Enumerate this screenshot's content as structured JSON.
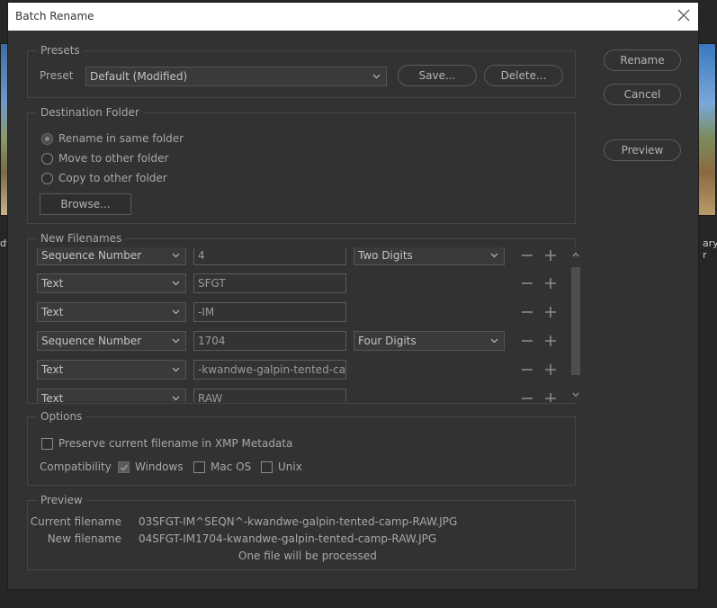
{
  "background": {
    "caption_left": "dv",
    "caption_right": "ary-r"
  },
  "dialog": {
    "title": "Batch Rename",
    "buttons": {
      "rename": "Rename",
      "cancel": "Cancel",
      "preview": "Preview"
    }
  },
  "presets": {
    "legend": "Presets",
    "preset_label": "Preset",
    "preset_value": "Default (Modified)",
    "save": "Save...",
    "delete": "Delete..."
  },
  "destination": {
    "legend": "Destination Folder",
    "options": [
      {
        "label": "Rename in same folder",
        "selected": true
      },
      {
        "label": "Move to other folder",
        "selected": false
      },
      {
        "label": "Copy to other folder",
        "selected": false
      }
    ],
    "browse": "Browse..."
  },
  "new_filenames": {
    "legend": "New Filenames",
    "rows": [
      {
        "type": "Sequence Number",
        "value": "4",
        "digits": "Two Digits"
      },
      {
        "type": "Text",
        "value": "SFGT",
        "digits": ""
      },
      {
        "type": "Text",
        "value": "-IM",
        "digits": ""
      },
      {
        "type": "Sequence Number",
        "value": "1704",
        "digits": "Four Digits"
      },
      {
        "type": "Text",
        "value": "-kwandwe-galpin-tented-camp",
        "digits": ""
      },
      {
        "type": "Text",
        "value": "RAW",
        "digits": ""
      }
    ]
  },
  "options": {
    "legend": "Options",
    "preserve": {
      "label": "Preserve current filename in XMP Metadata",
      "checked": false
    },
    "compat_label": "Compatibility",
    "compat": [
      {
        "label": "Windows",
        "checked": true
      },
      {
        "label": "Mac OS",
        "checked": false
      },
      {
        "label": "Unix",
        "checked": false
      }
    ]
  },
  "preview": {
    "legend": "Preview",
    "current_label": "Current filename",
    "current_value": "03SFGT-IM^SEQN^-kwandwe-galpin-tented-camp-RAW.JPG",
    "new_label": "New filename",
    "new_value": "04SFGT-IM1704-kwandwe-galpin-tented-camp-RAW.JPG",
    "summary": "One file will be processed"
  }
}
